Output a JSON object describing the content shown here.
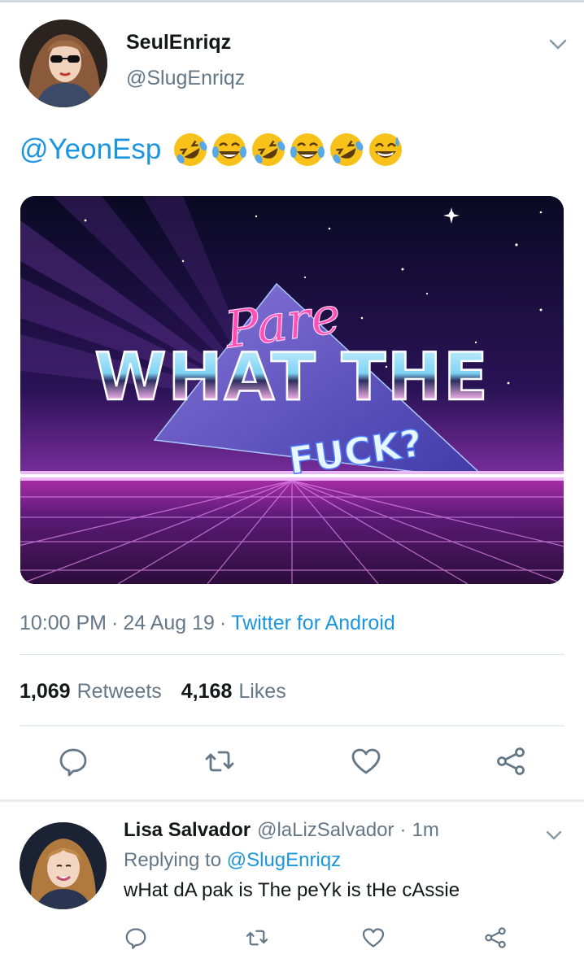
{
  "tweet": {
    "author_name": "SeulEnriqz",
    "author_handle": "@SlugEnriqz",
    "mention": "@YeonEsp",
    "emojis": [
      "rolling-on-floor-laughing",
      "tears-of-joy",
      "rolling-on-floor-laughing",
      "tears-of-joy",
      "rolling-on-floor-laughing",
      "grinning-sweat"
    ],
    "media": {
      "script_text": "Pare",
      "headline": "WHAT THE",
      "subline": "FUCK?"
    },
    "time": "10:00 PM",
    "date": "24 Aug 19",
    "source": "Twitter for Android",
    "sep": "·",
    "retweets_count": "1,069",
    "retweets_label": "Retweets",
    "likes_count": "4,168",
    "likes_label": "Likes"
  },
  "reply": {
    "author_name": "Lisa Salvador",
    "author_handle": "@laLizSalvador",
    "sep": "·",
    "time_ago": "1m",
    "replying_prefix": "Replying to",
    "replying_to": "@SlugEnriqz",
    "text": "wHat dA pak is The peYk is tHe cAssie"
  },
  "colors": {
    "accent": "#1b95e0",
    "secondary_text": "#657786",
    "primary_text": "#14171a",
    "icon_gray": "#657786"
  }
}
